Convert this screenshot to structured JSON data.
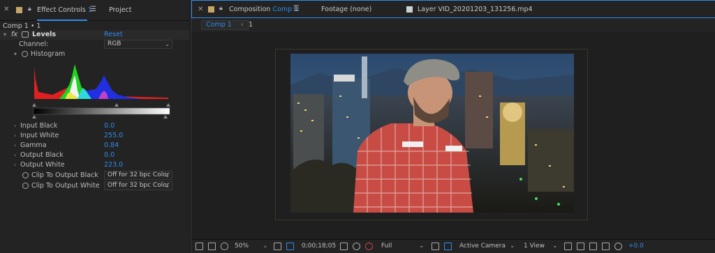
{
  "left_panel": {
    "tab_effect_controls": "Effect Controls",
    "tab_effect_controls_layer": "1",
    "tab_project": "Project",
    "breadcrumb": "Comp 1 • 1",
    "effect_name": "Levels",
    "reset_label": "Reset",
    "channel_label": "Channel:",
    "channel_value": "RGB",
    "histogram_label": "Histogram",
    "properties": [
      {
        "label": "Input Black",
        "value": "0.0"
      },
      {
        "label": "Input White",
        "value": "255.0"
      },
      {
        "label": "Gamma",
        "value": "0.84"
      },
      {
        "label": "Output Black",
        "value": "0.0"
      },
      {
        "label": "Output White",
        "value": "223.0"
      }
    ],
    "clip_black_label": "Clip To Output Black",
    "clip_black_value": "Off for 32 bpc Color",
    "clip_white_label": "Clip To Output White",
    "clip_white_value": "Off for 32 bpc Color"
  },
  "main_panel": {
    "tab_composition_prefix": "Composition",
    "tab_composition_name": "Comp 1",
    "tab_footage": "Footage (none)",
    "tab_layer": "Layer VID_20201203_131256.mp4",
    "comp_crumb": "Comp 1",
    "comp_crumb_sub": "1"
  },
  "bottom_bar": {
    "zoom": "50%",
    "timecode": "0;00;18;05",
    "resolution": "Full",
    "camera": "Active Camera",
    "views": "1 View",
    "exposure": "+0.0"
  },
  "colors": {
    "accent_blue": "#2d8ceb",
    "panel_bg": "#232323",
    "label_swatch": "#c4a66a"
  }
}
